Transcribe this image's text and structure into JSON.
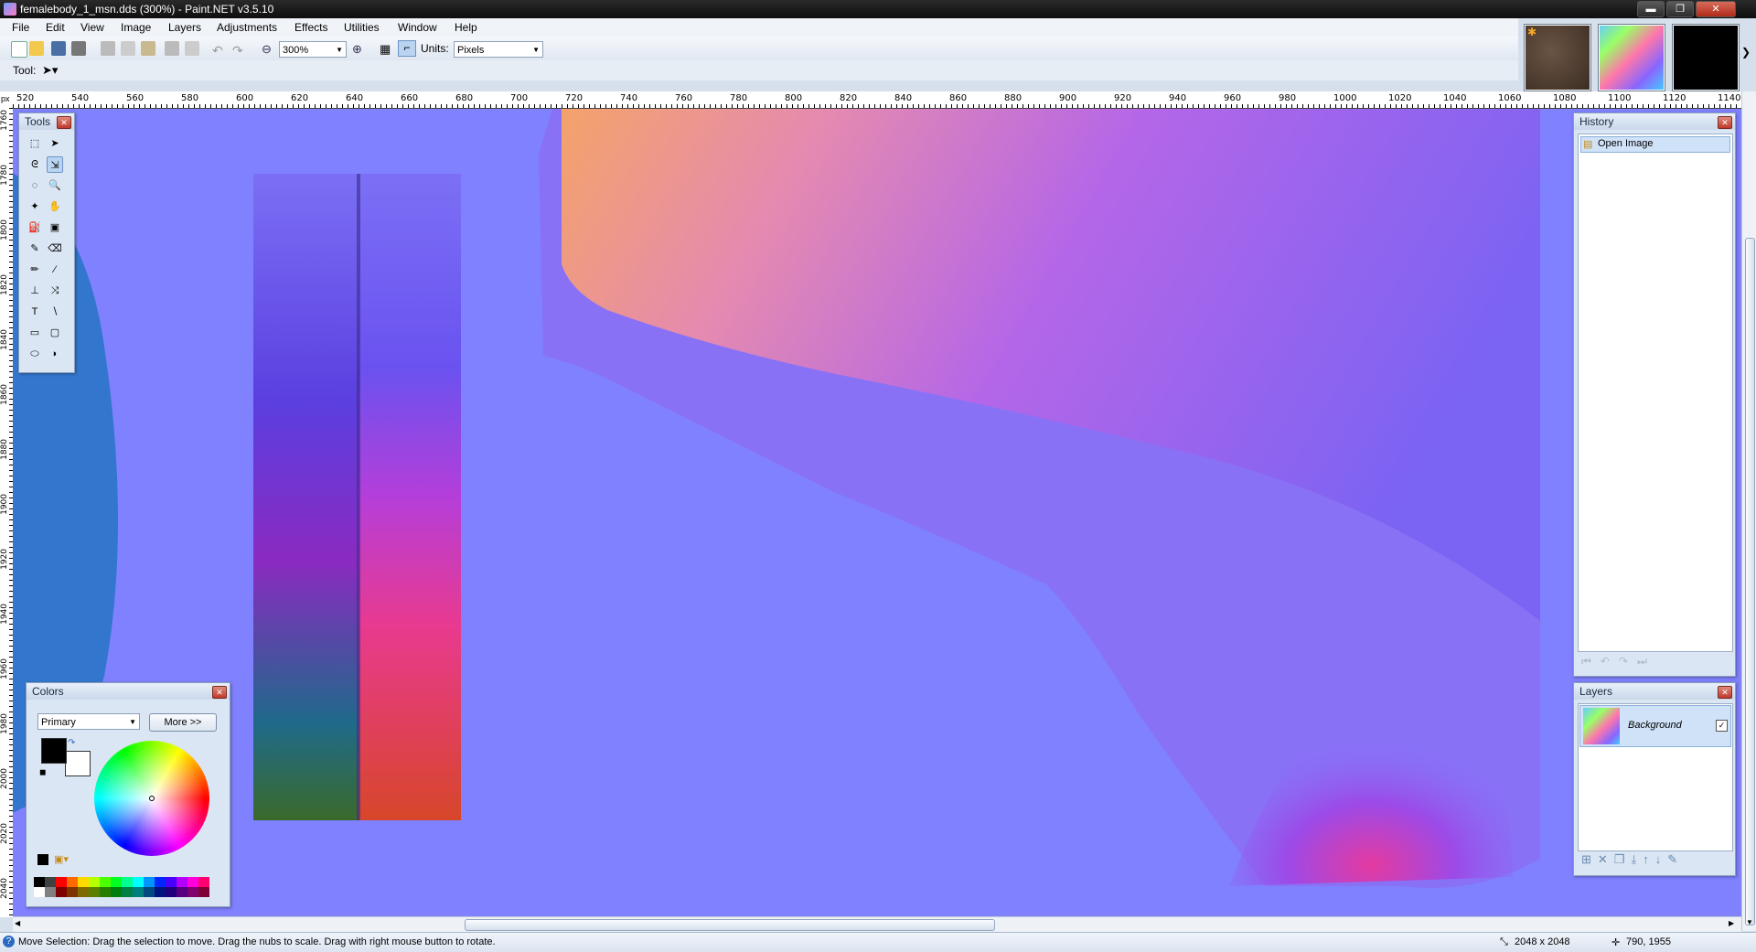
{
  "window": {
    "title": "femalebody_1_msn.dds (300%) - Paint.NET v3.5.10",
    "min_label": "▬",
    "max_label": "❐",
    "close_label": "✕"
  },
  "menu": [
    "File",
    "Edit",
    "View",
    "Image",
    "Layers",
    "Adjustments",
    "Effects",
    "Utilities",
    "Window",
    "Help"
  ],
  "toolbar": {
    "zoom_value": "300%",
    "units_label": "Units:",
    "units_value": "Pixels",
    "tool_label": "Tool:",
    "icons": [
      "new-icon",
      "open-icon",
      "save-icon",
      "print-icon",
      "cut-icon",
      "copy-icon",
      "paste-icon",
      "crop-icon",
      "deselect-icon",
      "undo-icon",
      "redo-icon",
      "zoom-out-icon",
      "zoom-in-icon",
      "grid-icon",
      "rulers-icon"
    ]
  },
  "ruler": {
    "unit": "px",
    "h_labels": [
      "520",
      "540",
      "560",
      "580",
      "600",
      "620",
      "640",
      "660",
      "680",
      "700",
      "720",
      "740",
      "760",
      "780",
      "800",
      "820",
      "840",
      "860",
      "880",
      "900",
      "920",
      "940",
      "960",
      "980",
      "1000",
      "1020",
      "1040",
      "1060",
      "1080",
      "1100",
      "1120",
      "1140"
    ],
    "v_labels": [
      "1760",
      "1780",
      "1800",
      "1820",
      "1840",
      "1860",
      "1880",
      "1900",
      "1920",
      "1940",
      "1960",
      "1980",
      "2000",
      "2020",
      "2040"
    ]
  },
  "tools_panel": {
    "title": "Tools",
    "tools": [
      {
        "name": "rectangle-select-tool",
        "glyph": "⬚"
      },
      {
        "name": "move-selected-pixels-tool",
        "glyph": "➤"
      },
      {
        "name": "lasso-select-tool",
        "glyph": "ᘓ"
      },
      {
        "name": "move-selection-tool",
        "glyph": "⇲"
      },
      {
        "name": "ellipse-select-tool",
        "glyph": "◌"
      },
      {
        "name": "zoom-tool",
        "glyph": "🔍"
      },
      {
        "name": "magic-wand-tool",
        "glyph": "✦"
      },
      {
        "name": "pan-tool",
        "glyph": "✋"
      },
      {
        "name": "paint-bucket-tool",
        "glyph": "⛽"
      },
      {
        "name": "gradient-tool",
        "glyph": "▣"
      },
      {
        "name": "paintbrush-tool",
        "glyph": "✎"
      },
      {
        "name": "eraser-tool",
        "glyph": "⌫"
      },
      {
        "name": "pencil-tool",
        "glyph": "✏"
      },
      {
        "name": "color-picker-tool",
        "glyph": "⁄"
      },
      {
        "name": "clone-stamp-tool",
        "glyph": "⊥"
      },
      {
        "name": "recolor-tool",
        "glyph": "⤨"
      },
      {
        "name": "text-tool",
        "glyph": "T"
      },
      {
        "name": "line-curve-tool",
        "glyph": "∖"
      },
      {
        "name": "rectangle-tool",
        "glyph": "▭"
      },
      {
        "name": "rounded-rectangle-tool",
        "glyph": "▢"
      },
      {
        "name": "ellipse-tool",
        "glyph": "⬭"
      },
      {
        "name": "freeform-shape-tool",
        "glyph": "◗"
      }
    ]
  },
  "history_panel": {
    "title": "History",
    "items": [
      "Open Image"
    ]
  },
  "layers_panel": {
    "title": "Layers",
    "layers": [
      {
        "name": "Background",
        "visible": true
      }
    ]
  },
  "colors_panel": {
    "title": "Colors",
    "mode": "Primary",
    "more_label": "More >>",
    "primary_color": "#000000",
    "secondary_color": "#ffffff",
    "palette": [
      "#000000",
      "#404040",
      "#ff0000",
      "#ff6a00",
      "#ffd800",
      "#b6ff00",
      "#4cff00",
      "#00ff21",
      "#00ff90",
      "#00ffff",
      "#0094ff",
      "#0026ff",
      "#4800ff",
      "#b200ff",
      "#ff00dc",
      "#ff006e"
    ],
    "palette2": [
      "#ffffff",
      "#808080",
      "#7f0000",
      "#7f3300",
      "#7f6a00",
      "#5b7f00",
      "#267f00",
      "#007f0e",
      "#007f46",
      "#007f7f",
      "#004a7f",
      "#00137f",
      "#21007f",
      "#57007f",
      "#7f006e",
      "#7f0037"
    ]
  },
  "status": {
    "message": "Move Selection: Drag the selection to move. Drag the nubs to scale. Drag with right mouse button to rotate.",
    "image_size": "2048 x 2048",
    "cursor": "790, 1955"
  }
}
